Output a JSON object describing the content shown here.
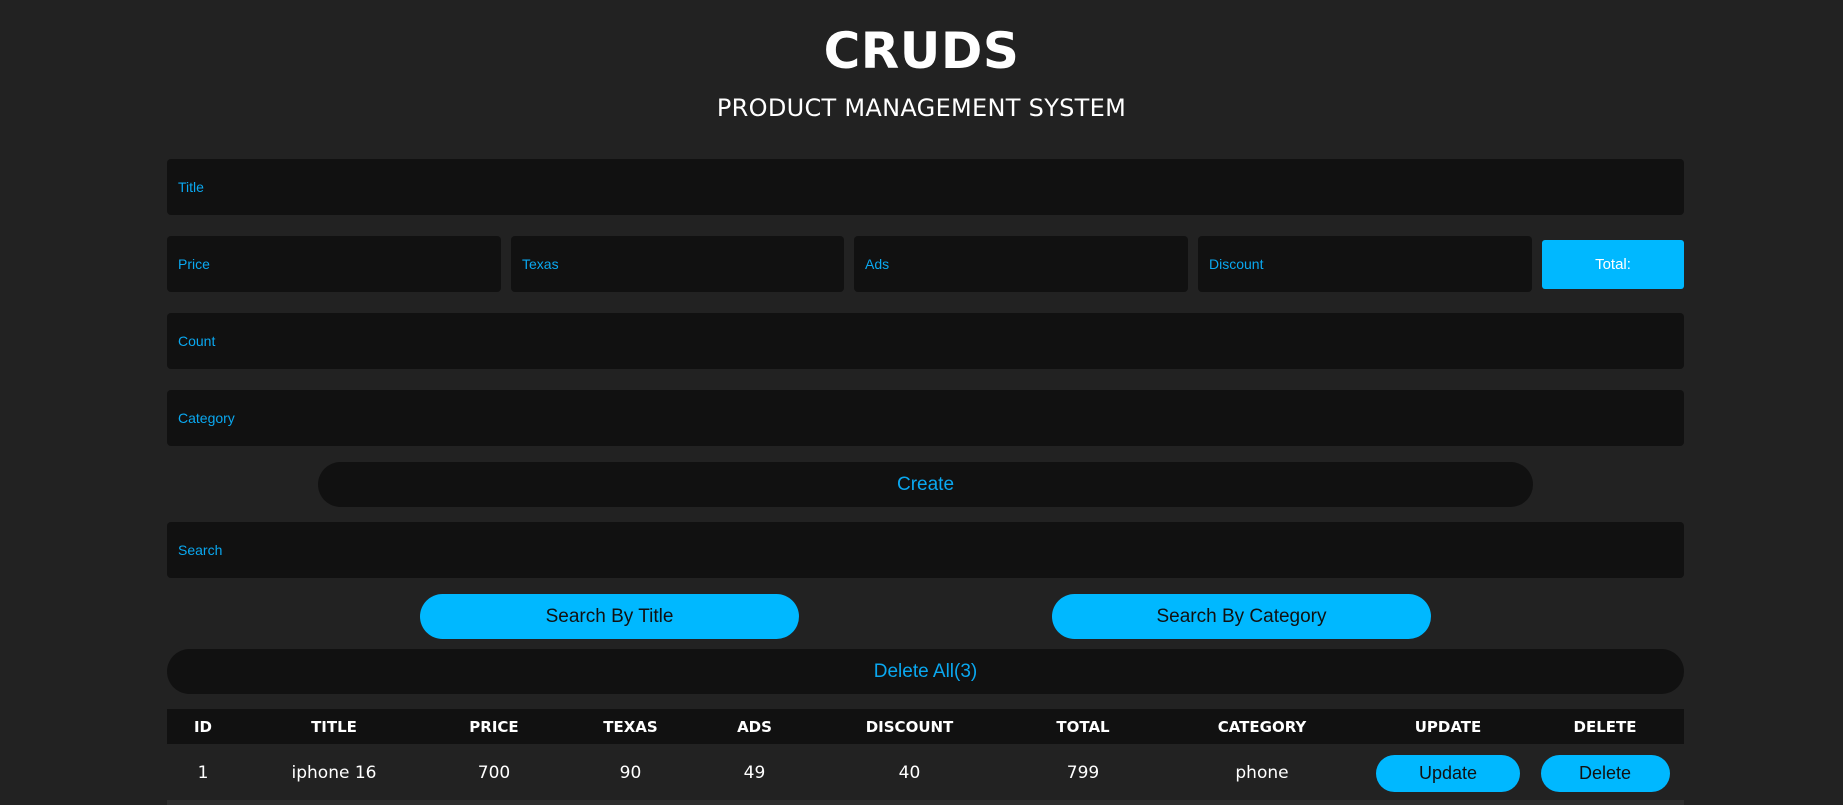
{
  "header": {
    "title": "CRUDS",
    "subtitle": "PRODUCT MANAGEMENT SYSTEM"
  },
  "form": {
    "title_placeholder": "Title",
    "price_placeholder": "Price",
    "taxes_placeholder": "Texas",
    "ads_placeholder": "Ads",
    "discount_placeholder": "Discount",
    "total_label": "Total:",
    "count_placeholder": "Count",
    "category_placeholder": "Category",
    "create_label": "Create"
  },
  "search": {
    "placeholder": "Search",
    "by_title_label": "Search By Title",
    "by_category_label": "Search By Category"
  },
  "delete_all_label": "Delete All(3)",
  "table": {
    "columns": [
      "ID",
      "TITLE",
      "PRICE",
      "TEXAS",
      "ADS",
      "DISCOUNT",
      "TOTAL",
      "CATEGORY",
      "UPDATE",
      "DELETE"
    ],
    "rows": [
      {
        "id": "1",
        "title": "iphone 16",
        "price": "700",
        "taxes": "90",
        "ads": "49",
        "discount": "40",
        "total": "799",
        "category": "phone",
        "update": "Update",
        "delete": "Delete"
      }
    ]
  },
  "colors": {
    "background": "#222222",
    "input_bg": "#111111",
    "accent": "#00b8ff",
    "placeholder": "#0aa8f0"
  }
}
